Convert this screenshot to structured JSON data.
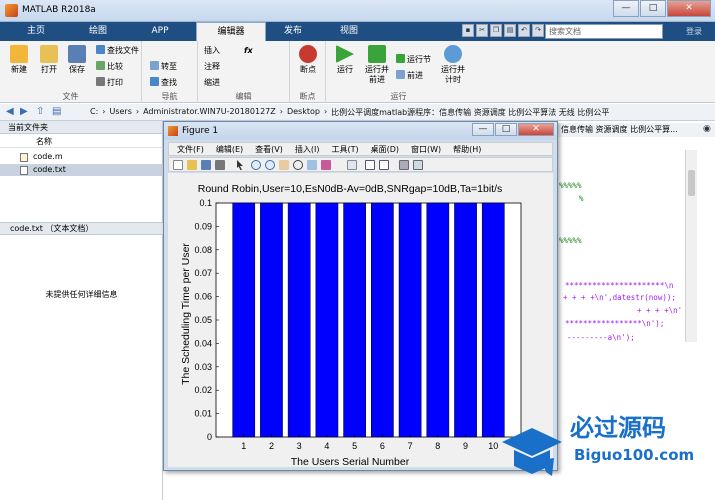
{
  "window": {
    "title": "MATLAB R2018a",
    "min": "—",
    "max": "□",
    "close": "✕"
  },
  "tabs": [
    "主页",
    "绘图",
    "APP",
    "编辑器",
    "发布",
    "视图"
  ],
  "active_tab": "编辑器",
  "search": {
    "placeholder": "搜索文档"
  },
  "login_label": "登录",
  "ribbon": {
    "file": {
      "new": "新建",
      "open": "打开",
      "save": "保存",
      "find_files": "查找文件",
      "compare": "比较",
      "print": "打印",
      "group": "文件"
    },
    "nav": {
      "goto": "转至",
      "find": "查找",
      "group": "导航"
    },
    "edit": {
      "insert": "插入",
      "comment": "注释",
      "indent": "缩进",
      "fx": "fx",
      "group": "编辑"
    },
    "breakpoints": {
      "label": "断点",
      "group": "断点"
    },
    "run": {
      "run": "运行",
      "run_advance": "运行并\n前进",
      "run_section": "运行节",
      "advance": "前进",
      "run_time": "运行并\n计时",
      "group": "运行"
    }
  },
  "address": {
    "crumbs": [
      "C:",
      "Users",
      "Administrator.WIN7U-20180127Z",
      "Desktop",
      "比例公平调度matlab源程序：信息传输 资源调度 比例公平算法 无线 比例公平"
    ]
  },
  "current_folder": {
    "title": "当前文件夹",
    "column_name": "名称",
    "files": [
      {
        "name": "code.m",
        "selected": false
      },
      {
        "name": "code.txt",
        "selected": true
      }
    ]
  },
  "details": {
    "title": "code.txt （文本文档）",
    "empty": "未提供任何详细信息"
  },
  "editor_behind": {
    "title_fragment": "信息传输 资源调度 比例公平算...",
    "lines": [
      "%%%%%",
      "%",
      "%%%%%",
      "**********************\\n",
      "+ + + +\\n',datestr(now));",
      "+ + + +\\n'",
      "*****************\\n');",
      "---------a\\n');"
    ]
  },
  "figure": {
    "title": "Figure 1",
    "menu": [
      "文件(F)",
      "编辑(E)",
      "查看(V)",
      "插入(I)",
      "工具(T)",
      "桌面(D)",
      "窗口(W)",
      "帮助(H)"
    ]
  },
  "chart_data": {
    "type": "bar",
    "title": "Round Robin,User=10,EsN0dB-Av=0dB,SNRgap=10dB,Ta=1bit/s",
    "xlabel": "The Users Serial Number",
    "ylabel": "The Scheduling Time per User",
    "categories": [
      "1",
      "2",
      "3",
      "4",
      "5",
      "6",
      "7",
      "8",
      "9",
      "10"
    ],
    "values": [
      0.1,
      0.1,
      0.1,
      0.1,
      0.1,
      0.1,
      0.1,
      0.1,
      0.1,
      0.1
    ],
    "ylim": [
      0,
      0.1
    ],
    "yticks": [
      "0",
      "0.01",
      "0.02",
      "0.03",
      "0.04",
      "0.05",
      "0.06",
      "0.07",
      "0.08",
      "0.09",
      "0.1"
    ],
    "bar_color": "#0000ff",
    "grid": false
  },
  "watermark": {
    "brand": "必过源码",
    "site": "Biguo100.com"
  },
  "colors": {
    "tabbar": "#1f4f82",
    "bar": "#0000ff",
    "watermark": "#1a6fc9"
  }
}
